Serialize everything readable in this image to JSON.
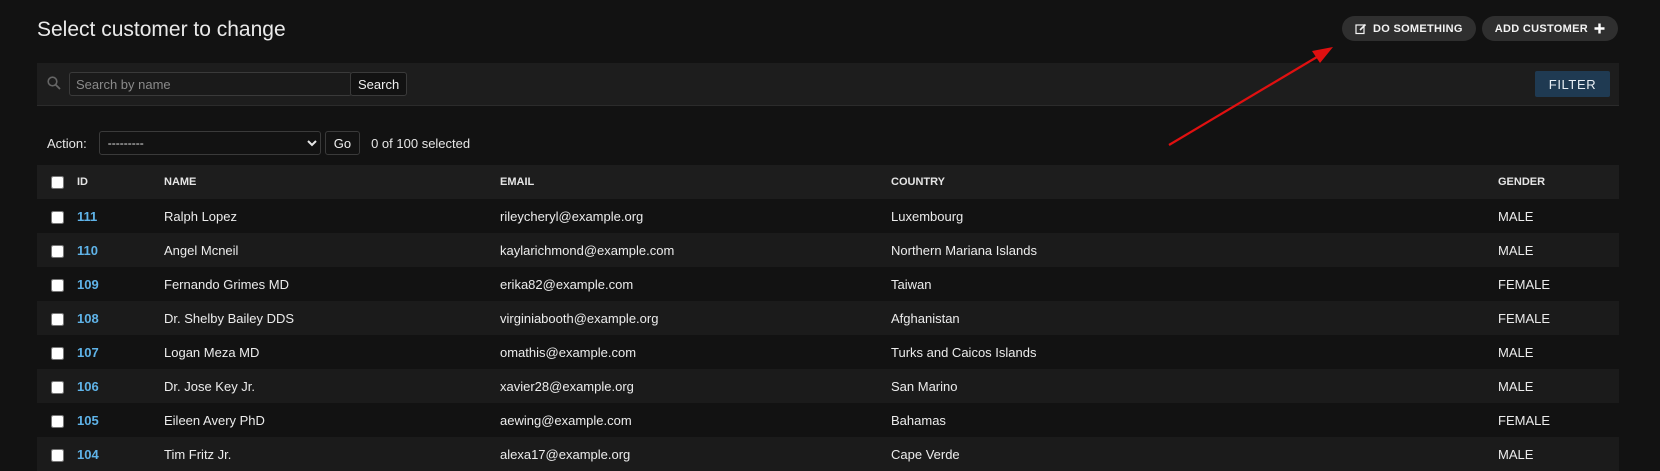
{
  "header": {
    "title": "Select customer to change",
    "do_something_label": "DO SOMETHING",
    "add_customer_label": "ADD CUSTOMER"
  },
  "search": {
    "placeholder": "Search by name",
    "button_label": "Search",
    "filter_label": "FILTER"
  },
  "actions": {
    "label": "Action:",
    "selected_option": "---------",
    "go_label": "Go",
    "selected_count": "0 of 100 selected"
  },
  "table": {
    "columns": [
      "ID",
      "NAME",
      "EMAIL",
      "COUNTRY",
      "GENDER"
    ],
    "rows": [
      {
        "id": "111",
        "name": "Ralph Lopez",
        "email": "rileycheryl@example.org",
        "country": "Luxembourg",
        "gender": "MALE"
      },
      {
        "id": "110",
        "name": "Angel Mcneil",
        "email": "kaylarichmond@example.com",
        "country": "Northern Mariana Islands",
        "gender": "MALE"
      },
      {
        "id": "109",
        "name": "Fernando Grimes MD",
        "email": "erika82@example.com",
        "country": "Taiwan",
        "gender": "FEMALE"
      },
      {
        "id": "108",
        "name": "Dr. Shelby Bailey DDS",
        "email": "virginiabooth@example.org",
        "country": "Afghanistan",
        "gender": "FEMALE"
      },
      {
        "id": "107",
        "name": "Logan Meza MD",
        "email": "omathis@example.com",
        "country": "Turks and Caicos Islands",
        "gender": "MALE"
      },
      {
        "id": "106",
        "name": "Dr. Jose Key Jr.",
        "email": "xavier28@example.org",
        "country": "San Marino",
        "gender": "MALE"
      },
      {
        "id": "105",
        "name": "Eileen Avery PhD",
        "email": "aewing@example.com",
        "country": "Bahamas",
        "gender": "FEMALE"
      },
      {
        "id": "104",
        "name": "Tim Fritz Jr.",
        "email": "alexa17@example.org",
        "country": "Cape Verde",
        "gender": "MALE"
      }
    ]
  },
  "colors": {
    "background": "#121212",
    "link": "#5fb3e8",
    "filter_button": "#1f3a52",
    "annotation_arrow": "#e01010"
  }
}
